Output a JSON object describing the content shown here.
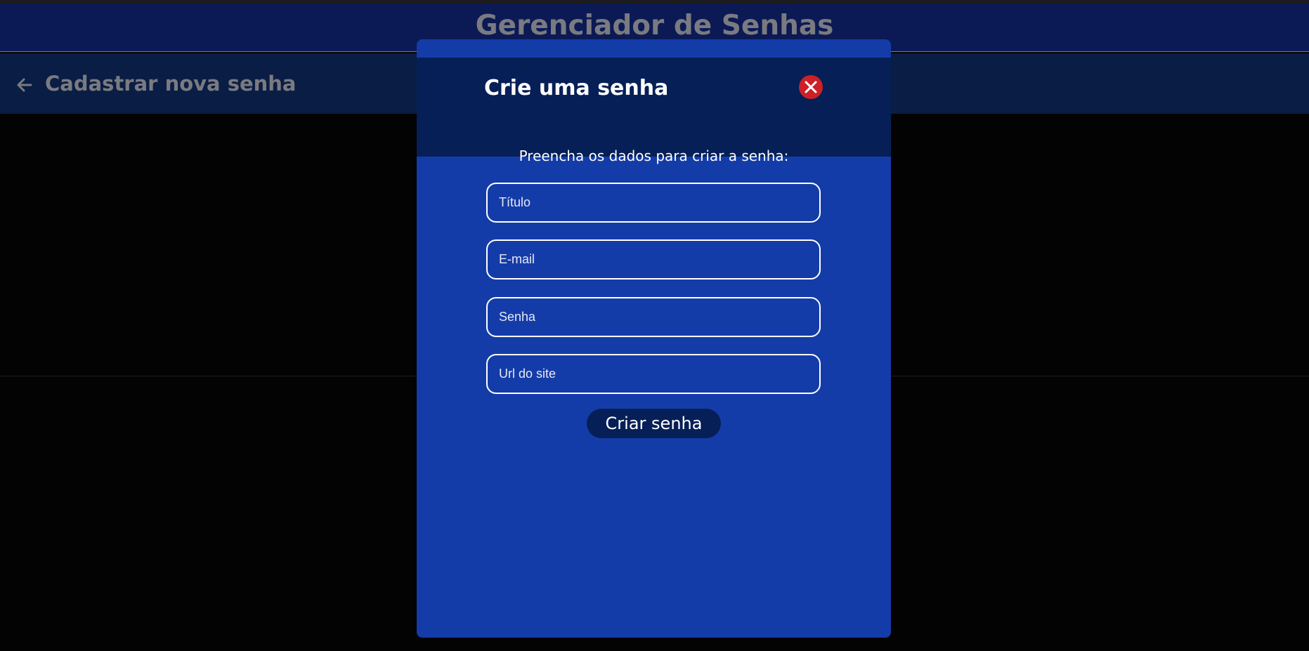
{
  "app": {
    "title": "Gerenciador de Senhas"
  },
  "subheader": {
    "back_icon": "arrow-left-icon",
    "title": "Cadastrar nova senha"
  },
  "modal": {
    "title": "Crie uma senha",
    "close_icon": "close-icon",
    "instruction": "Preencha os dados para criar a senha:",
    "fields": {
      "title": {
        "value": "",
        "placeholder": "Título"
      },
      "email": {
        "value": "",
        "placeholder": "E-mail"
      },
      "password": {
        "value": "",
        "placeholder": "Senha"
      },
      "url": {
        "value": "",
        "placeholder": "Url do site"
      }
    },
    "submit_label": "Criar senha"
  },
  "colors": {
    "background": "#040304",
    "header": "#0b1a55",
    "subheader": "#091d45",
    "modal": "#143ca9",
    "modal_header": "#061f57",
    "close_button": "#cc2126",
    "muted_text": "#7a7a80"
  }
}
